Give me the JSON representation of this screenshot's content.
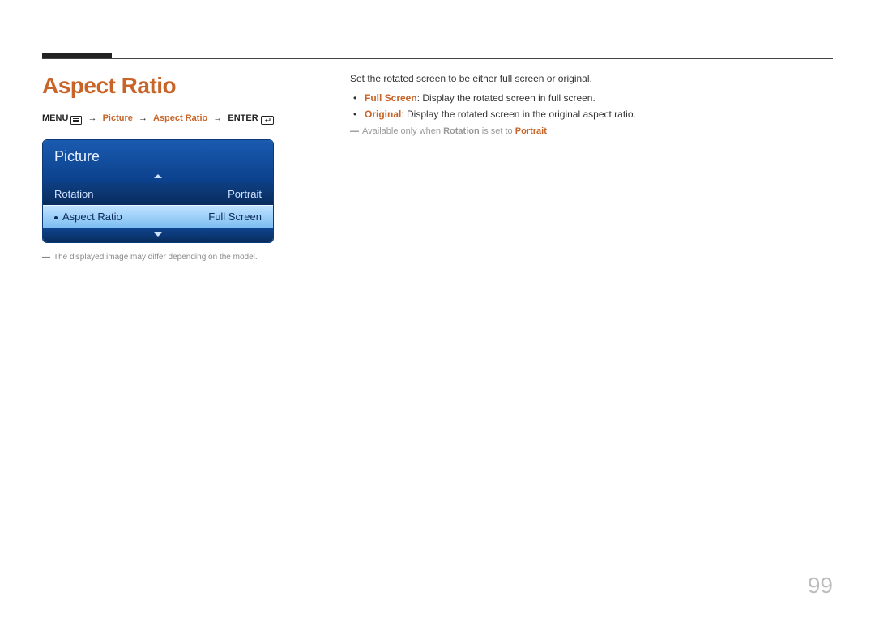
{
  "page_number": "99",
  "heading": "Aspect Ratio",
  "navpath": {
    "menu_label": "MENU",
    "picture": "Picture",
    "aspect_ratio": "Aspect Ratio",
    "enter_label": "ENTER",
    "arrow": "→"
  },
  "osd": {
    "title": "Picture",
    "rows": [
      {
        "label": "Rotation",
        "value": "Portrait"
      },
      {
        "label": "Aspect Ratio",
        "value": "Full Screen"
      }
    ]
  },
  "footnote": "The displayed image may differ depending on the model.",
  "right": {
    "lead": "Set the rotated screen to be either full screen or original.",
    "options": [
      {
        "name": "Full Screen",
        "desc": ": Display the rotated screen in full screen."
      },
      {
        "name": "Original",
        "desc": ": Display the rotated screen in the original aspect ratio."
      }
    ],
    "note_prefix": "Available only when ",
    "note_strong1": "Rotation",
    "note_mid": " is set to ",
    "note_strong2": "Portrait",
    "note_suffix": "."
  }
}
